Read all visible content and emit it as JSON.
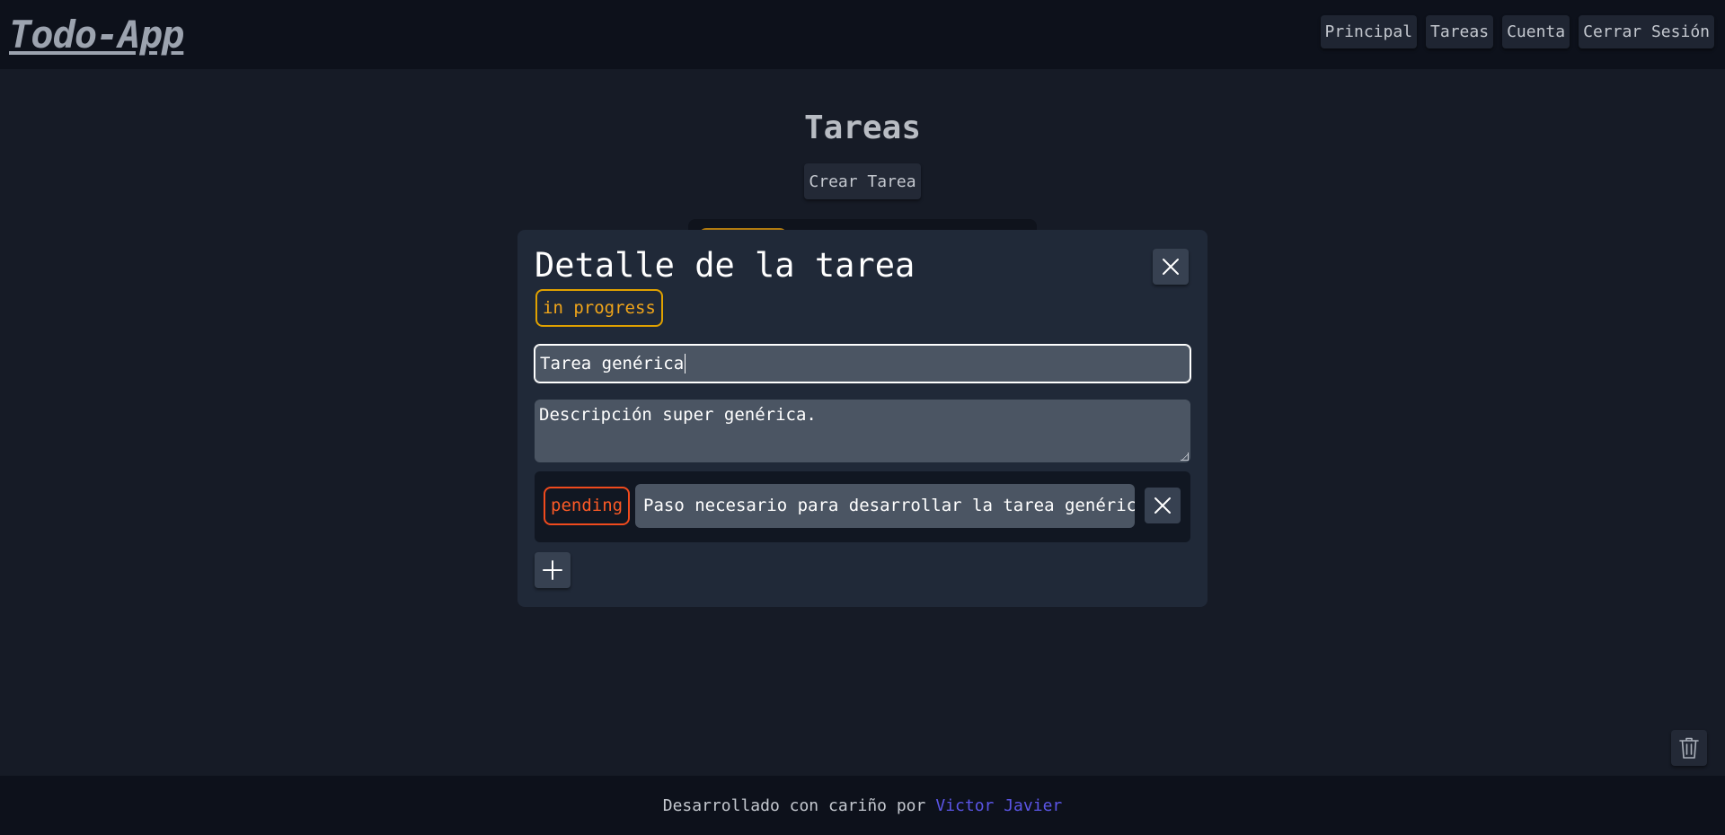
{
  "header": {
    "logo": "Todo-App",
    "nav": [
      {
        "label": "Principal"
      },
      {
        "label": "Tareas"
      },
      {
        "label": "Cuenta"
      },
      {
        "label": "Cerrar Sesión"
      }
    ]
  },
  "main": {
    "title": "Tareas",
    "create_label": "Crear Tarea"
  },
  "modal": {
    "title": "Detalle de la tarea",
    "status": "in progress",
    "task_title": "Tarea genérica",
    "description": "Descripción super genérica.",
    "steps": [
      {
        "status": "pending",
        "text": "Paso necesario para desarrollar la tarea genérica"
      }
    ]
  },
  "footer": {
    "text": "Desarrollado con cariño por",
    "author": "Victor Javier"
  },
  "colors": {
    "in_progress": "#e0a100",
    "pending": "#f04a1d",
    "link": "#5b55e6"
  },
  "icons": {
    "close": "close-icon",
    "add": "plus-icon",
    "trash": "trash-icon"
  }
}
